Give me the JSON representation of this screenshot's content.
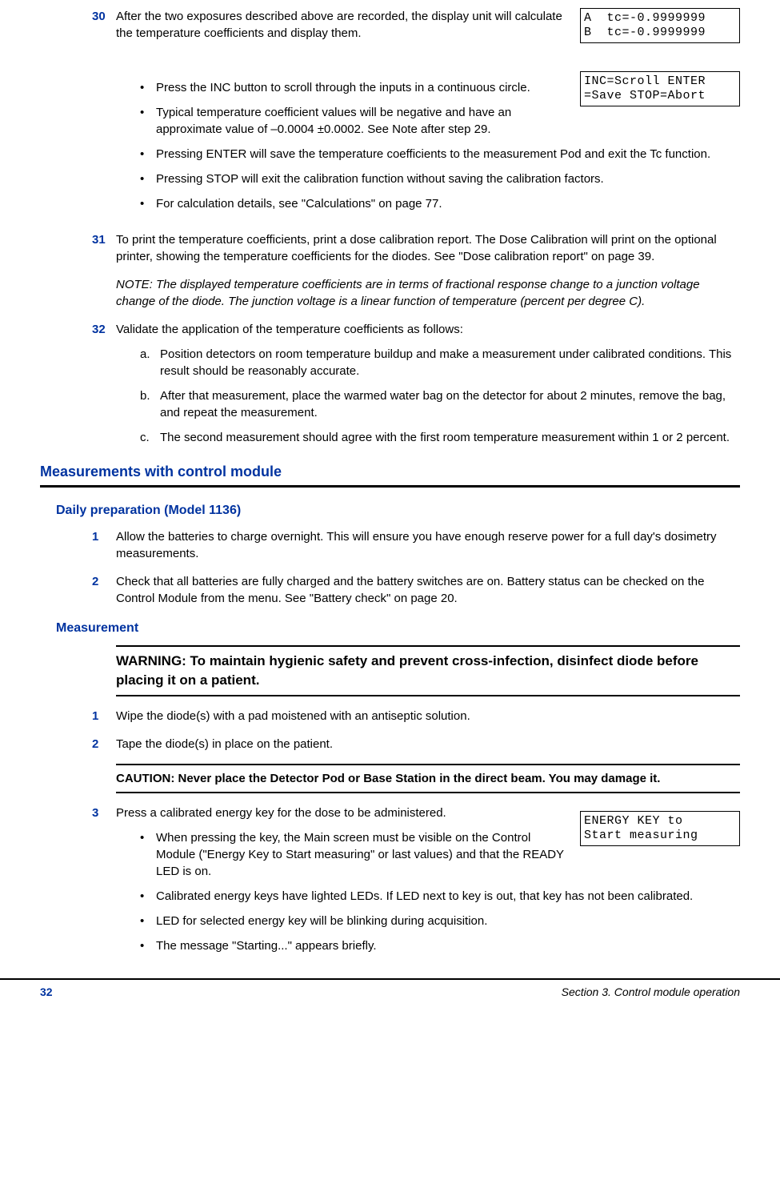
{
  "lcd1": {
    "line1": "A  tc=-0.9999999",
    "line2": "B  tc=-0.9999999"
  },
  "lcd2": {
    "line1": "INC=Scroll ENTER",
    "line2": "=Save STOP=Abort"
  },
  "lcd3": {
    "line1": "ENERGY KEY to",
    "line2": "Start measuring"
  },
  "step30": {
    "num": "30",
    "text": "After the two exposures described above are recorded, the display unit will calculate the temperature coefficients and display them.",
    "bullets": [
      "Press the INC button to scroll through the inputs in a continuous circle.",
      "Typical temperature coefficient values will be negative and have an approximate value of –0.0004 ±0.0002. See Note after step 29.",
      "Pressing ENTER will save the temperature coefficients to the measurement Pod and exit the Tc function.",
      "Pressing STOP will exit the calibration function without saving the calibration factors.",
      "For calculation details, see \"Calculations\" on page 77."
    ]
  },
  "step31": {
    "num": "31",
    "text": "To print the temperature coefficients, print a dose calibration report. The Dose Calibration will print on the optional printer, showing the temperature coefficients for the diodes. See \"Dose calibration report\" on page 39."
  },
  "note1": "NOTE: The displayed temperature coefficients are in terms of fractional response change to a junction voltage change of the diode. The junction voltage is a linear function of temperature (percent per degree C).",
  "step32": {
    "num": "32",
    "text": "Validate the application of the temperature coefficients as follows:",
    "sub": [
      {
        "l": "a.",
        "t": "Position detectors on room temperature buildup and make a measurement under calibrated conditions. This result should be reasonably accurate."
      },
      {
        "l": "b.",
        "t": "After that measurement, place the warmed water bag on the detector for about 2 minutes, remove the bag, and repeat the measurement."
      },
      {
        "l": "c.",
        "t": "The second measurement should agree with the first room temperature measurement within 1 or 2 percent."
      }
    ]
  },
  "h1a": "Measurements with control module",
  "h2a": "Daily preparation (Model 1136)",
  "daily": [
    {
      "n": "1",
      "t": "Allow the batteries to charge overnight. This will ensure you have enough reserve power for a full day's dosimetry measurements."
    },
    {
      "n": "2",
      "t": "Check that all batteries are fully charged and the battery switches are on. Battery status can be checked on the Control Module from the menu. See \"Battery check\" on page 20."
    }
  ],
  "h2b": "Measurement",
  "warning": "WARNING:  To maintain hygienic safety and prevent cross-infection, disinfect diode before placing it on a patient.",
  "meas": [
    {
      "n": "1",
      "t": "Wipe the diode(s) with a pad moistened with an antiseptic solution."
    },
    {
      "n": "2",
      "t": "Tape the diode(s) in place on the patient."
    }
  ],
  "caution": "CAUTION: Never place the Detector Pod or Base Station in the direct beam. You may damage it.",
  "step3": {
    "n": "3",
    "t": "Press a calibrated energy key for the dose to be administered.",
    "bullets": [
      "When pressing the key, the Main screen must be visible on the Control Module (\"Energy Key to Start measuring\" or last values) and that the READY LED is on.",
      "Calibrated energy keys have lighted LEDs. If LED next to key is out, that key has not been calibrated.",
      "LED for selected energy key will be blinking during acquisition.",
      "The message \"Starting...\" appears briefly."
    ]
  },
  "footer": {
    "page": "32",
    "section": "Section 3. Control module operation"
  }
}
